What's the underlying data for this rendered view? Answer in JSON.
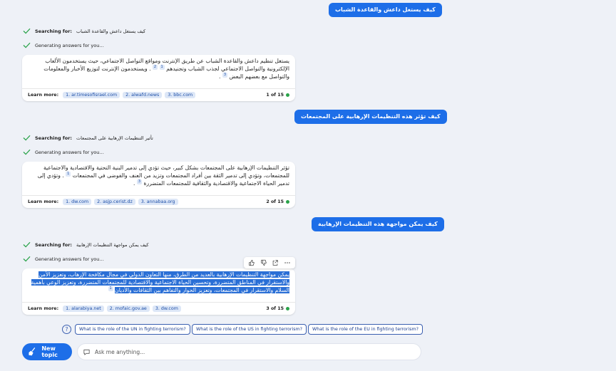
{
  "conversation": [
    {
      "question": "كيف يستغل داعش والقاعدة الشباب",
      "search_prefix": "Searching for:",
      "search_query": "كيف يستغل داعش والقاعدة الشباب",
      "generating": "Generating answers for you…",
      "answer": [
        "يستغل تنظيم داعش والقاعدة الشباب عن طريق الإنترنت ومواقع التواصل الاجتماعي، حيث يستخدمون الألعاب",
        "الإلكترونية والتواصل الاجتماعي لجذب الشباب وتجنيدهم",
        "1",
        "2",
        ". ويستخدمون الإنترنت لتوزيع الأخبار والمعلومات",
        "والتواصل مع بعضهم البعض",
        "3",
        "."
      ],
      "learn_more": "Learn more:",
      "links": [
        "1. ar.timesofisrael.com",
        "2. alwafd.news",
        "3. bbc.com"
      ],
      "counter": "1 of 15"
    },
    {
      "question": "كيف تؤثر هذه التنظيمات الإرهابية على المجتمعات",
      "search_prefix": "Searching for:",
      "search_query": "تأثير التنظيمات الإرهابية على المجتمعات",
      "generating": "Generating answers for you…",
      "answer": [
        "تؤثر التنظيمات الإرهابية على المجتمعات بشكل كبير، حيث تؤدي إلى تدمير البنية التحتية والاقتصادية والاجتماعية",
        "للمجتمعات، وتؤدي إلى تدمير الثقة بين أفراد المجتمعات وتزيد من العنف والفوضى في المجتمعات",
        "1",
        ". وتؤدي إلى",
        "تدمير الحياة الاجتماعية والاقتصادية والثقافية للمجتمعات المتضررة",
        "3",
        "."
      ],
      "learn_more": "Learn more:",
      "links": [
        "1. dw.com",
        "2. asjp.cerist.dz",
        "3. annabaa.org"
      ],
      "counter": "2 of 15"
    },
    {
      "question": "كيف يمكن مواجهة هذه التنظيمات الإرهابية",
      "search_prefix": "Searching for:",
      "search_query": "كيف يمكن مواجهة التنظيمات الإرهابية",
      "generating": "Generating answers for you…",
      "answer": [
        "يمكن مواجهة التنظيمات الإرهابية بالعديد من الطرق، منها التعاون الدولي في مجال مكافحة الإرهاب، وتعزيز الأمن",
        "والاستقرار في المناطق المتضررة، وتحسين الحياة الاجتماعية والاقتصادية للمجتمعات المتضررة، وتعزيز الوعي بأهمية",
        "السلام والاستقرار في المجتمعات، وتعزيز الحوار والتفاهم بين الثقافات والأديان",
        "1"
      ],
      "learn_more": "Learn more:",
      "links": [
        "1. alarabiya.net",
        "2. mofaic.gov.ae",
        "3. dw.com"
      ],
      "counter": "3 of 15"
    }
  ],
  "suggestions": [
    "What is the role of the UN in fighting terrorism?",
    "What is the role of the US in fighting terrorism?",
    "What is the role of the EU in fighting terrorism?"
  ],
  "new_topic_label": "New topic",
  "ask_placeholder": "Ask me anything...",
  "colors": {
    "accent": "#1d6ee8",
    "background": "#eef1f7",
    "check": "#2aa34a",
    "selection": "#2a6fd6"
  },
  "icons": [
    "check-icon",
    "thumbs-up-icon",
    "thumbs-down-icon",
    "share-icon",
    "more-icon",
    "help-icon",
    "broom-icon",
    "chat-icon"
  ]
}
